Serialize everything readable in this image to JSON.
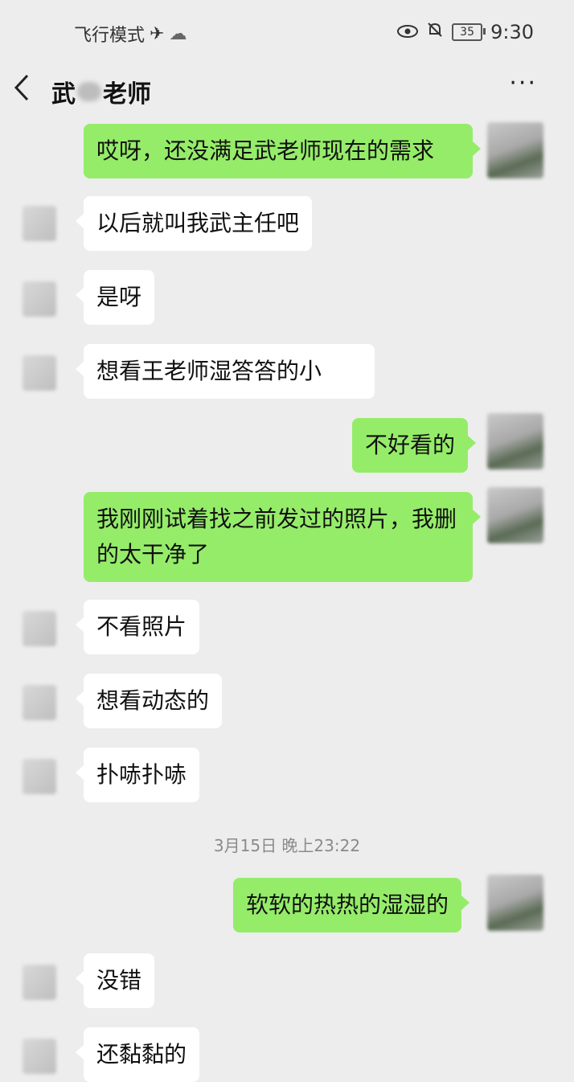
{
  "status_bar": {
    "airplane_text": "飞行模式",
    "battery": "35",
    "time": "9:30"
  },
  "nav": {
    "title_part1": "武",
    "title_part2": "老师",
    "more": "···"
  },
  "messages": [
    {
      "dir": "out",
      "text": "哎呀，还没满足武老师现在的需求"
    },
    {
      "dir": "in",
      "text": "以后就叫我武主任吧"
    },
    {
      "dir": "in",
      "text": "是呀"
    },
    {
      "dir": "in",
      "text": "想看王老师湿答答的小"
    },
    {
      "dir": "out",
      "text": "不好看的"
    },
    {
      "dir": "out",
      "text": "我刚刚试着找之前发过的照片，我删的太干净了"
    },
    {
      "dir": "in",
      "text": "不看照片"
    },
    {
      "dir": "in",
      "text": "想看动态的"
    },
    {
      "dir": "in",
      "text": "扑哧扑哧"
    },
    {
      "dir": "out",
      "text": "软软的热热的湿湿的"
    },
    {
      "dir": "in",
      "text": "没错"
    },
    {
      "dir": "in",
      "text": "还黏黏的"
    }
  ],
  "timestamp": "3月15日 晚上23:22",
  "icons": {
    "airplane": "airplane-icon",
    "cloud": "cloud-icon",
    "eye": "eye-icon",
    "mute": "bell-off-icon",
    "back": "chevron-left-icon",
    "more": "more-dots-icon"
  }
}
